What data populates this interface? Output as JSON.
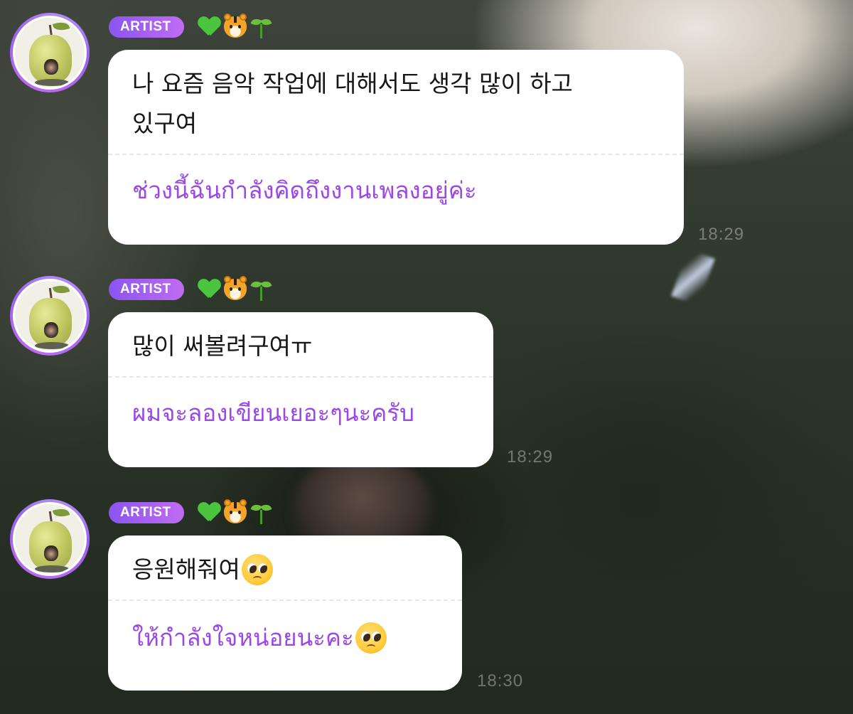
{
  "messages": [
    {
      "sender_badge": "ARTIST",
      "badge_emojis": [
        "green-heart",
        "tiger-face",
        "seedling"
      ],
      "original_line1": "나 요즘 음악 작업에 대해서도 생각 많이 하고",
      "original_line2": "있구여",
      "translation": "ช่วงนี้ฉันกำลังคิดถึงงานเพลงอยู่ค่ะ",
      "time": "18:29"
    },
    {
      "sender_badge": "ARTIST",
      "badge_emojis": [
        "green-heart",
        "tiger-face",
        "seedling"
      ],
      "original_line1": "많이 써볼려구여ㅠ",
      "translation": "ผมจะลองเขียนเยอะๆนะครับ",
      "time": "18:29"
    },
    {
      "sender_badge": "ARTIST",
      "badge_emojis": [
        "green-heart",
        "tiger-face",
        "seedling"
      ],
      "original_line1": "응원해줘여",
      "original_emoji": "pleading-face",
      "translation": "ให้กำลังใจหน่อยนะคะ",
      "translation_emoji": "pleading-face",
      "time": "18:30"
    }
  ],
  "colors": {
    "badge_gradient_start": "#8a55f0",
    "badge_gradient_end": "#c06cf2",
    "translation_text": "#9a48e6",
    "bubble_bg": "#ffffff"
  }
}
